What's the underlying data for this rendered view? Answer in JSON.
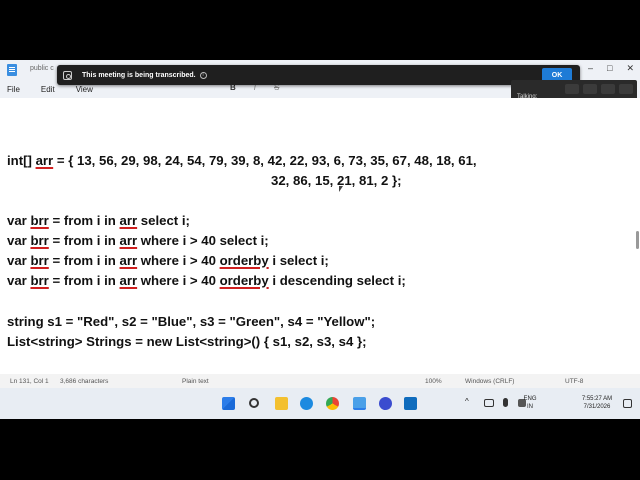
{
  "titlebar": {
    "tab_title": "public c",
    "controls": [
      "–",
      "□",
      "✕"
    ]
  },
  "menu": {
    "items": [
      "File",
      "Edit",
      "View"
    ],
    "format_tools": [
      "B",
      "I",
      "S"
    ]
  },
  "banner": {
    "text": "This meeting is being transcribed.",
    "ok_label": "OK"
  },
  "talking_panel": {
    "label": "Talking:"
  },
  "editor": {
    "lines": {
      "l1": "int[] arr = { 13, 56, 29, 98, 24, 54, 79, 39, 8, 42, 22, 93, 6, 73, 35, 67, 48, 18, 61,",
      "l2": "32, 86, 15, 21, 81, 2 };",
      "l3a": "var ",
      "l3b": "brr",
      "l3c": " = from i in ",
      "l3d": "arr",
      "l3e": " select i;",
      "l4a": "var ",
      "l4b": "brr",
      "l4c": " = from i in ",
      "l4d": "arr",
      "l4e": " where i > 40 select i;",
      "l5a": "var ",
      "l5b": "brr",
      "l5c": " = from i in ",
      "l5d": "arr",
      "l5e": " where i > 40 ",
      "l5f": "orderby",
      "l5g": " i select i;",
      "l6a": "var ",
      "l6b": "brr",
      "l6c": " = from i in ",
      "l6d": "arr",
      "l6e": " where i > 40 ",
      "l6f": "orderby",
      "l6g": " i descending select i;",
      "l7": "string s1 = \"Red\", s2 = \"Blue\", s3 = \"Green\", s4 = \"Yellow\";",
      "l8": "List<string> Strings = new List<string>() { s1, s2, s3, s4 };"
    },
    "l1_prefix": "int[] ",
    "l1_arr": "arr",
    "l1_rest": " = { 13, 56, 29, 98, 24, 54, 79, 39, 8, 42, 22, 93, 6, 73, 35, 67, 48, 18, 61,"
  },
  "statusbar": {
    "position": "Ln 131, Col 1",
    "characters": "3,686 characters",
    "format": "Plain text",
    "zoom": "100%",
    "line_ending": "Windows (CRLF)",
    "encoding": "UTF-8"
  },
  "taskbar": {
    "language_line1": "ENG",
    "language_line2": "IN",
    "time": "7:55:27 AM",
    "date": "7/31/2026"
  },
  "colors": {
    "banner_bg": "#1f1f1f",
    "ok_button": "#1e7bd6",
    "squiggle": "#d02020"
  }
}
